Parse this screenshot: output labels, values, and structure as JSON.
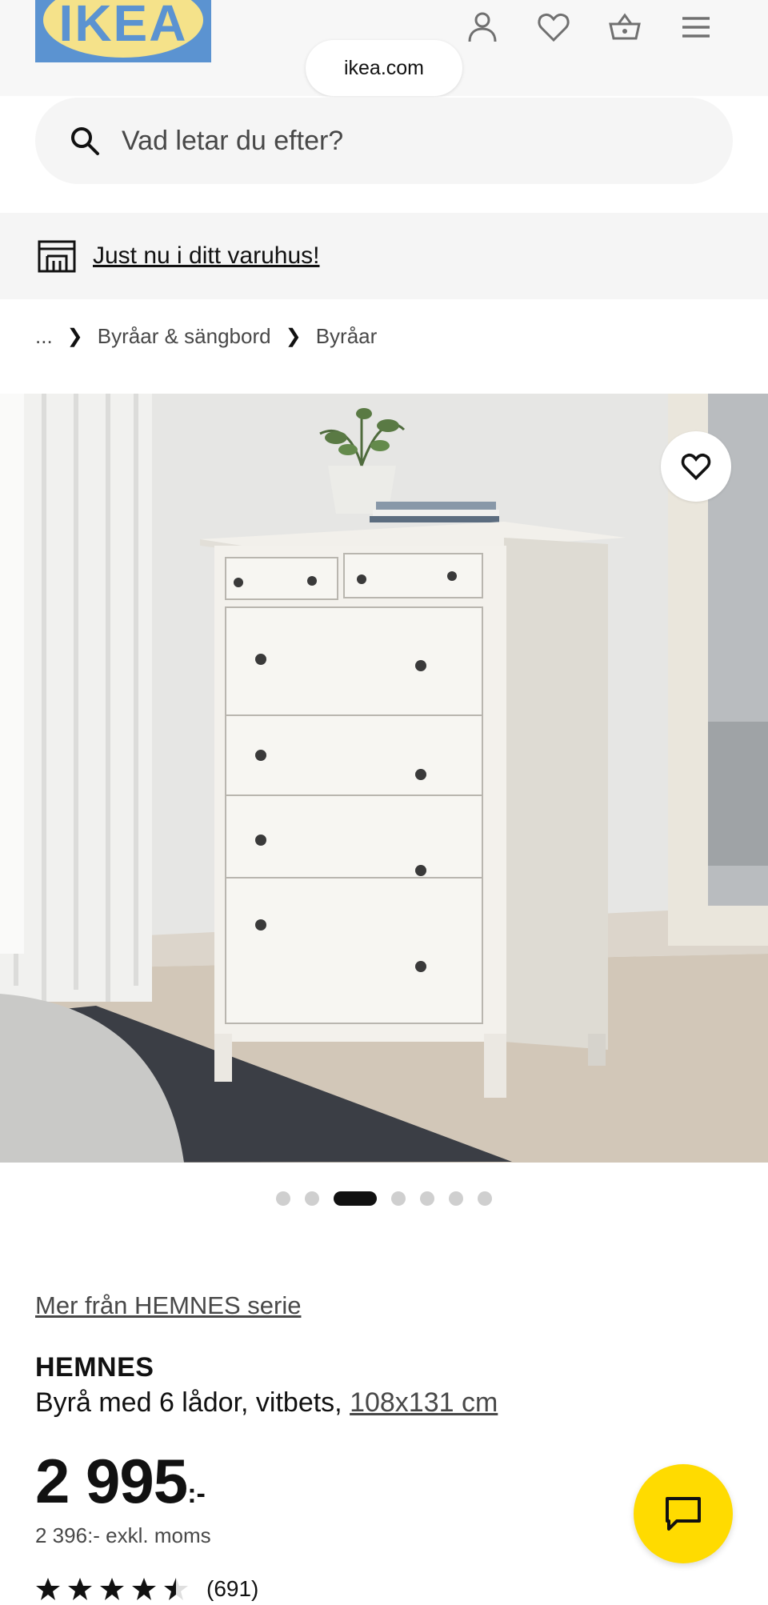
{
  "header": {
    "logo_text": "IKEA",
    "url": "ikea.com",
    "icons": [
      "user-icon",
      "heart-icon",
      "shopping-basket-icon",
      "menu-icon"
    ]
  },
  "search": {
    "placeholder": "Vad letar du efter?",
    "icon": "search-icon"
  },
  "store_banner": {
    "icon": "store-icon",
    "label": "Just nu i ditt varuhus!"
  },
  "breadcrumb": {
    "items": [
      "...",
      "Byråar & sängbord",
      "Byråar"
    ]
  },
  "gallery": {
    "slide_count": 7,
    "active_slide": 3,
    "favorite_icon": "heart-icon"
  },
  "product": {
    "series_link": "Mer från HEMNES serie",
    "name": "HEMNES",
    "description": "Byrå med 6 lådor, vitbets, ",
    "size": "108x131 cm",
    "price": "2 995",
    "price_suffix": ":-",
    "price_ex_vat": "2 396:- exkl. moms",
    "rating": 4.5,
    "review_count": "(691)"
  },
  "chat": {
    "icon": "chat-icon"
  },
  "colors": {
    "ikea_blue": "#0058A3",
    "ikea_yellow": "#FFDB00",
    "text": "#111111",
    "muted_text": "#484848",
    "light_bg": "#F5F5F5"
  }
}
